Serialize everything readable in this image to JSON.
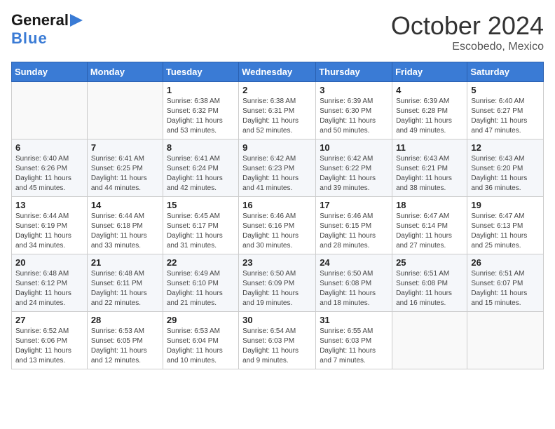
{
  "logo": {
    "general": "General",
    "blue": "Blue",
    "arrow": "▶"
  },
  "title": "October 2024",
  "location": "Escobedo, Mexico",
  "headers": [
    "Sunday",
    "Monday",
    "Tuesday",
    "Wednesday",
    "Thursday",
    "Friday",
    "Saturday"
  ],
  "weeks": [
    [
      {
        "day": "",
        "info": ""
      },
      {
        "day": "",
        "info": ""
      },
      {
        "day": "1",
        "info": "Sunrise: 6:38 AM\nSunset: 6:32 PM\nDaylight: 11 hours and 53 minutes."
      },
      {
        "day": "2",
        "info": "Sunrise: 6:38 AM\nSunset: 6:31 PM\nDaylight: 11 hours and 52 minutes."
      },
      {
        "day": "3",
        "info": "Sunrise: 6:39 AM\nSunset: 6:30 PM\nDaylight: 11 hours and 50 minutes."
      },
      {
        "day": "4",
        "info": "Sunrise: 6:39 AM\nSunset: 6:28 PM\nDaylight: 11 hours and 49 minutes."
      },
      {
        "day": "5",
        "info": "Sunrise: 6:40 AM\nSunset: 6:27 PM\nDaylight: 11 hours and 47 minutes."
      }
    ],
    [
      {
        "day": "6",
        "info": "Sunrise: 6:40 AM\nSunset: 6:26 PM\nDaylight: 11 hours and 45 minutes."
      },
      {
        "day": "7",
        "info": "Sunrise: 6:41 AM\nSunset: 6:25 PM\nDaylight: 11 hours and 44 minutes."
      },
      {
        "day": "8",
        "info": "Sunrise: 6:41 AM\nSunset: 6:24 PM\nDaylight: 11 hours and 42 minutes."
      },
      {
        "day": "9",
        "info": "Sunrise: 6:42 AM\nSunset: 6:23 PM\nDaylight: 11 hours and 41 minutes."
      },
      {
        "day": "10",
        "info": "Sunrise: 6:42 AM\nSunset: 6:22 PM\nDaylight: 11 hours and 39 minutes."
      },
      {
        "day": "11",
        "info": "Sunrise: 6:43 AM\nSunset: 6:21 PM\nDaylight: 11 hours and 38 minutes."
      },
      {
        "day": "12",
        "info": "Sunrise: 6:43 AM\nSunset: 6:20 PM\nDaylight: 11 hours and 36 minutes."
      }
    ],
    [
      {
        "day": "13",
        "info": "Sunrise: 6:44 AM\nSunset: 6:19 PM\nDaylight: 11 hours and 34 minutes."
      },
      {
        "day": "14",
        "info": "Sunrise: 6:44 AM\nSunset: 6:18 PM\nDaylight: 11 hours and 33 minutes."
      },
      {
        "day": "15",
        "info": "Sunrise: 6:45 AM\nSunset: 6:17 PM\nDaylight: 11 hours and 31 minutes."
      },
      {
        "day": "16",
        "info": "Sunrise: 6:46 AM\nSunset: 6:16 PM\nDaylight: 11 hours and 30 minutes."
      },
      {
        "day": "17",
        "info": "Sunrise: 6:46 AM\nSunset: 6:15 PM\nDaylight: 11 hours and 28 minutes."
      },
      {
        "day": "18",
        "info": "Sunrise: 6:47 AM\nSunset: 6:14 PM\nDaylight: 11 hours and 27 minutes."
      },
      {
        "day": "19",
        "info": "Sunrise: 6:47 AM\nSunset: 6:13 PM\nDaylight: 11 hours and 25 minutes."
      }
    ],
    [
      {
        "day": "20",
        "info": "Sunrise: 6:48 AM\nSunset: 6:12 PM\nDaylight: 11 hours and 24 minutes."
      },
      {
        "day": "21",
        "info": "Sunrise: 6:48 AM\nSunset: 6:11 PM\nDaylight: 11 hours and 22 minutes."
      },
      {
        "day": "22",
        "info": "Sunrise: 6:49 AM\nSunset: 6:10 PM\nDaylight: 11 hours and 21 minutes."
      },
      {
        "day": "23",
        "info": "Sunrise: 6:50 AM\nSunset: 6:09 PM\nDaylight: 11 hours and 19 minutes."
      },
      {
        "day": "24",
        "info": "Sunrise: 6:50 AM\nSunset: 6:08 PM\nDaylight: 11 hours and 18 minutes."
      },
      {
        "day": "25",
        "info": "Sunrise: 6:51 AM\nSunset: 6:08 PM\nDaylight: 11 hours and 16 minutes."
      },
      {
        "day": "26",
        "info": "Sunrise: 6:51 AM\nSunset: 6:07 PM\nDaylight: 11 hours and 15 minutes."
      }
    ],
    [
      {
        "day": "27",
        "info": "Sunrise: 6:52 AM\nSunset: 6:06 PM\nDaylight: 11 hours and 13 minutes."
      },
      {
        "day": "28",
        "info": "Sunrise: 6:53 AM\nSunset: 6:05 PM\nDaylight: 11 hours and 12 minutes."
      },
      {
        "day": "29",
        "info": "Sunrise: 6:53 AM\nSunset: 6:04 PM\nDaylight: 11 hours and 10 minutes."
      },
      {
        "day": "30",
        "info": "Sunrise: 6:54 AM\nSunset: 6:03 PM\nDaylight: 11 hours and 9 minutes."
      },
      {
        "day": "31",
        "info": "Sunrise: 6:55 AM\nSunset: 6:03 PM\nDaylight: 11 hours and 7 minutes."
      },
      {
        "day": "",
        "info": ""
      },
      {
        "day": "",
        "info": ""
      }
    ]
  ]
}
